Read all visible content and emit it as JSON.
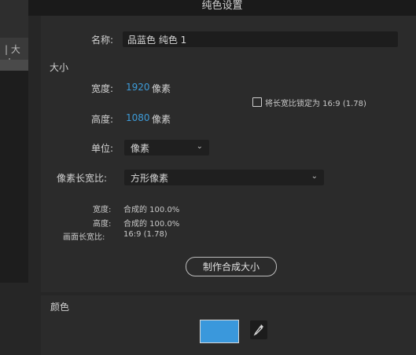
{
  "background_app": {
    "tab_fragment": "| 大小"
  },
  "dialog": {
    "title": "纯色设置",
    "name_label": "名称:",
    "name_value": "品蓝色 纯色 1",
    "size_section_label": "大小",
    "width_label": "宽度:",
    "width_value": "1920",
    "height_label": "高度:",
    "height_value": "1080",
    "pixel_unit": "像素",
    "lock_aspect_label": "将长宽比锁定为 16:9 (1.78)",
    "lock_aspect_checked": false,
    "units_label": "单位:",
    "units_value": "像素",
    "pixel_aspect_label": "像素长宽比:",
    "pixel_aspect_value": "方形像素",
    "info_width_label": "宽度:",
    "info_width_value": "合成的 100.0%",
    "info_height_label": "高度:",
    "info_height_value": "合成的 100.0%",
    "info_frame_label": "画面长宽比:",
    "info_frame_value": "16:9 (1.78)",
    "make_comp_size_button": "制作合成大小",
    "color_section_label": "颜色",
    "color_value": "#3a98dc"
  }
}
